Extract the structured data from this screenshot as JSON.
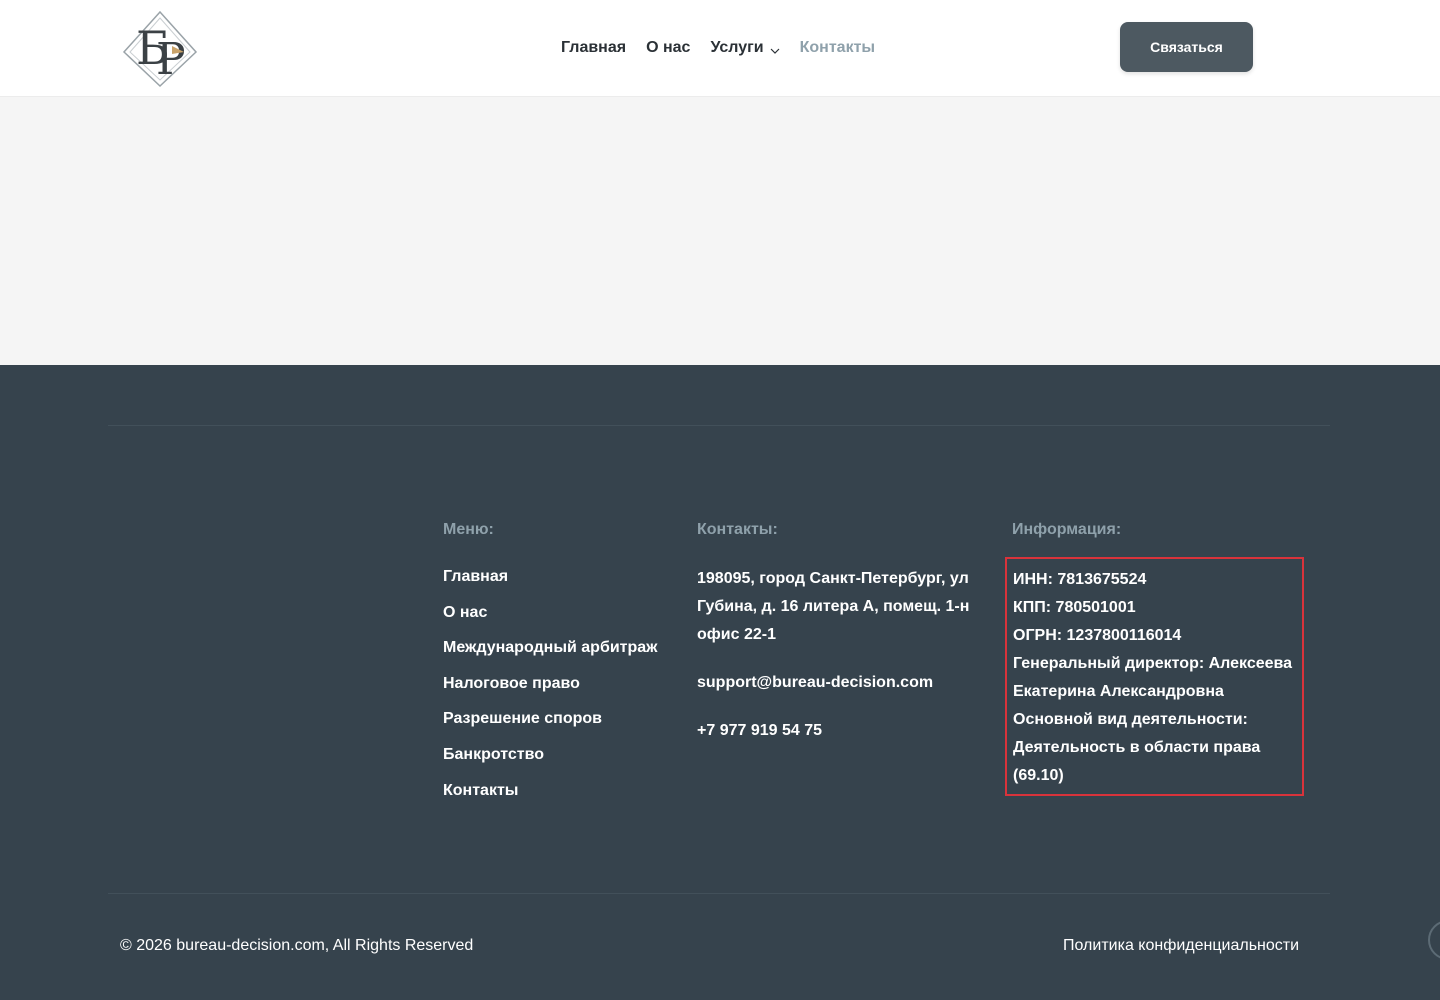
{
  "header": {
    "logo_alt": "БР",
    "nav": [
      {
        "label": "Главная",
        "active": false,
        "dropdown": false
      },
      {
        "label": "О нас",
        "active": false,
        "dropdown": false
      },
      {
        "label": "Услуги",
        "active": false,
        "dropdown": true
      },
      {
        "label": "Контакты",
        "active": true,
        "dropdown": false
      }
    ],
    "cta_label": "Связаться"
  },
  "footer": {
    "menu": {
      "title": "Меню:",
      "items": [
        "Главная",
        "О нас",
        "Международный арбитраж",
        "Налоговое право",
        "Разрешение споров",
        "Банкротство",
        "Контакты"
      ]
    },
    "contacts": {
      "title": "Контакты:",
      "address": "198095, город Санкт-Петербург, ул Губина, д. 16 литера А, помещ. 1-н офис 22-1",
      "email": "support@bureau-decision.com",
      "phone": "+7 977 919 54 75"
    },
    "info": {
      "title": "Информация:",
      "lines": [
        "ИНН: 7813675524",
        "КПП: 780501001",
        "ОГРН: 1237800116014",
        "Генеральный директор: Алексеева Екатерина Александровна",
        "Основной вид деятельности: Деятельность в области права (69.10)"
      ]
    },
    "copyright": "© 2026 bureau-decision.com, All Rights Reserved",
    "policy_label": "Политика конфиденциальности"
  },
  "colors": {
    "footer_bg": "#36434d",
    "accent_muted": "#8fa1ab",
    "cta_bg": "#4d5961",
    "highlight_border": "#d9333b"
  }
}
